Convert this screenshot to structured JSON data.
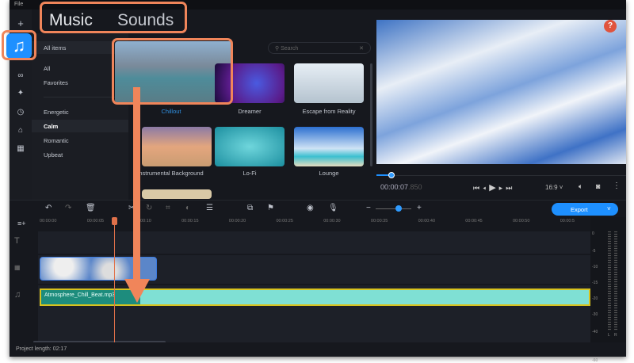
{
  "menu": {
    "file": "File"
  },
  "tabs": {
    "music": "Music",
    "sounds": "Sounds"
  },
  "categories": {
    "header": "All items",
    "items": [
      "All",
      "Favorites"
    ],
    "moods": [
      "Energetic",
      "Calm",
      "Romantic",
      "Upbeat"
    ],
    "selected": "Calm"
  },
  "search": {
    "placeholder": "Search"
  },
  "tracks": [
    {
      "label": "Chillout",
      "selected": true
    },
    {
      "label": "Dreamer"
    },
    {
      "label": "Escape from Reality"
    },
    {
      "label": "Instrumental Background"
    },
    {
      "label": "Lo-Fi"
    },
    {
      "label": "Lounge"
    }
  ],
  "player": {
    "time": "00:00:07",
    "ms": ".850",
    "aspect": "16:9",
    "progress": 0.06
  },
  "help": "?",
  "export": {
    "label": "Export"
  },
  "ruler": [
    "00:00:00",
    "00:00:05",
    "00:00:10",
    "00:00:15",
    "00:00:20",
    "00:00:25",
    "00:00:30",
    "00:00:35",
    "00:00:40",
    "00:00:45",
    "00:00:50",
    "00:00:5"
  ],
  "audio_clip": {
    "name": "Atmosphere_Chill_Beat.mp3"
  },
  "meter": {
    "ticks": [
      "0",
      "-5",
      "-10",
      "-15",
      "-20",
      "-30",
      "-40",
      "-50",
      "-60"
    ],
    "lr": [
      "L",
      "R"
    ]
  },
  "status": {
    "project_length": "Project length: 02:17"
  },
  "colors": {
    "accent": "#1e90ff",
    "annotation": "#f0855a",
    "audio": "#7fe0d4"
  }
}
